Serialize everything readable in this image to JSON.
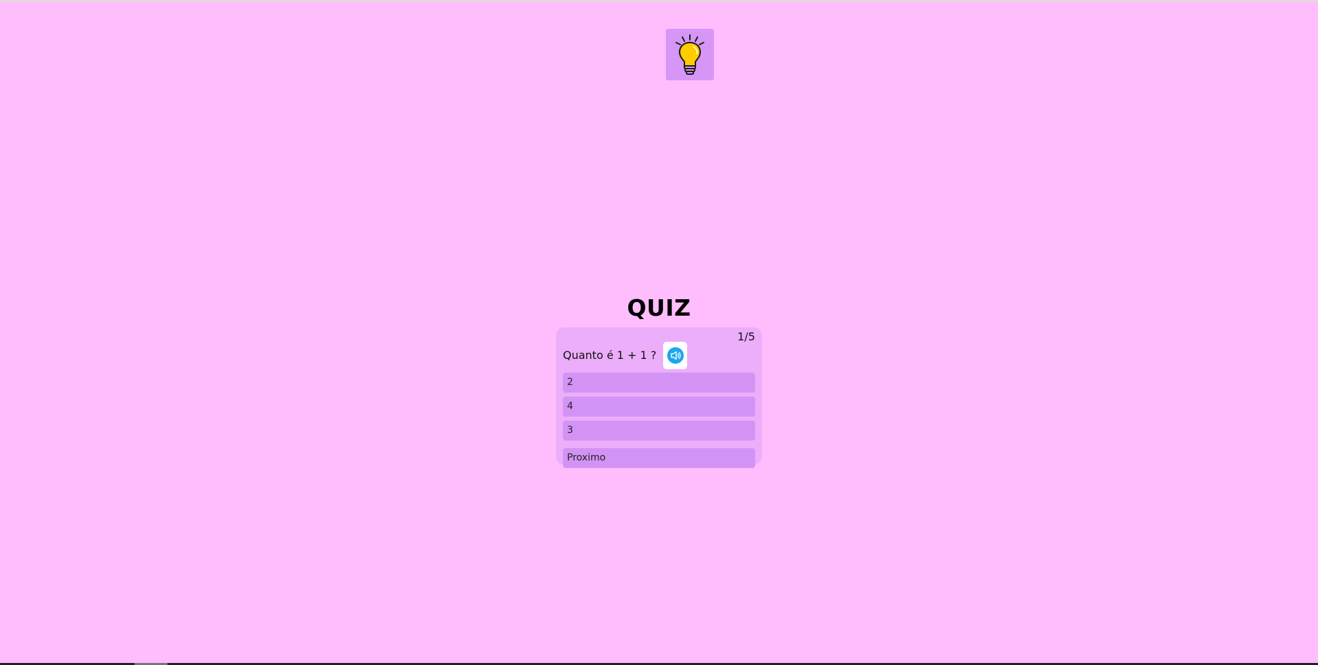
{
  "header": {
    "logo_icon": "lightbulb-icon"
  },
  "quiz": {
    "title": "QUIZ",
    "counter": "1/5",
    "question": "Quanto é 1 + 1 ?",
    "sound_icon": "speaker-icon",
    "answers": [
      {
        "label": "2"
      },
      {
        "label": "4"
      },
      {
        "label": "3"
      }
    ],
    "next_label": "Proximo"
  },
  "colors": {
    "background": "#ffbdfe",
    "card": "#ecadfa",
    "option": "#d293f5",
    "logo_tile": "#d596f6",
    "sound_icon": "#1aa7ec",
    "bulb": "#ffcc00"
  }
}
